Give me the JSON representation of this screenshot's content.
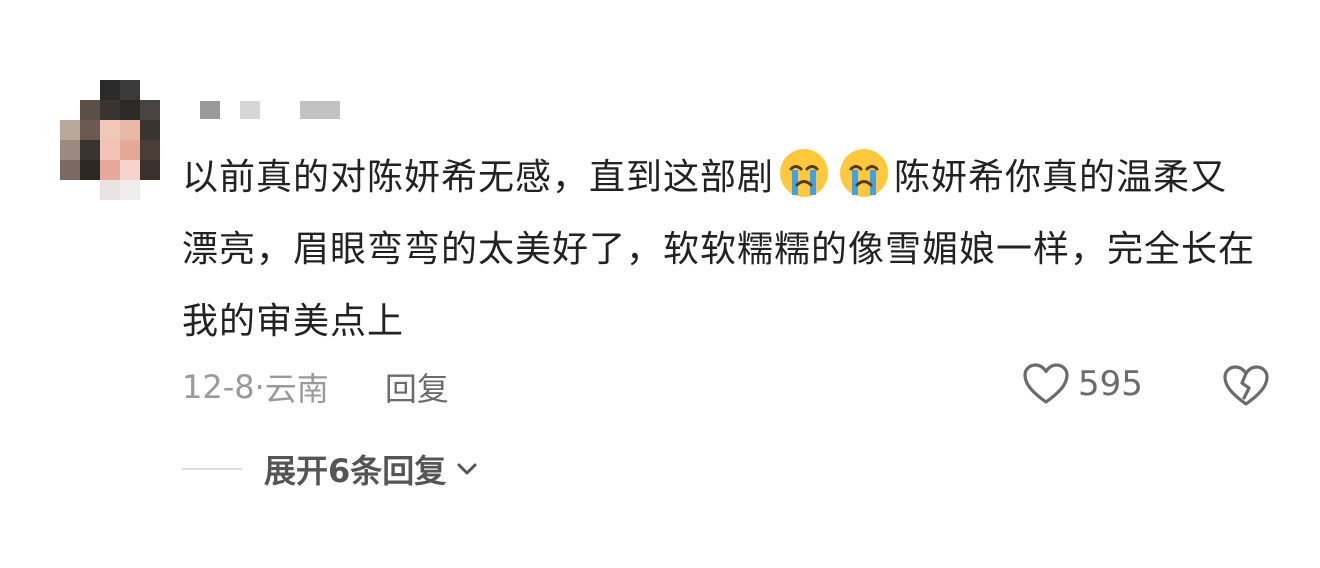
{
  "comment": {
    "segments": [
      {
        "type": "text",
        "value": "以前真的对陈妍希无感，直到这部剧"
      },
      {
        "type": "emoji",
        "name": "loudly-crying-face-emoji"
      },
      {
        "type": "emoji",
        "name": "loudly-crying-face-emoji"
      },
      {
        "type": "text",
        "value": "陈妍希你真的温柔又漂亮，眉眼弯弯的太美好了，软软糯糯的像雪媚娘一样，完全长在我的审美点上"
      }
    ]
  },
  "meta": {
    "date": "12-8",
    "separator": "·",
    "location": "云南",
    "reply_label": "回复"
  },
  "like": {
    "icon": "heart-icon",
    "count": "595"
  },
  "dislike": {
    "icon": "broken-heart-icon"
  },
  "expand": {
    "label": "展开6条回复",
    "icon": "chevron-down-icon"
  },
  "colors": {
    "text": "#222222",
    "meta": "#9a9a9a",
    "icon": "#6b6b6b",
    "emoji_face": "#FFC83D",
    "emoji_tears": "#3FA2E8"
  }
}
